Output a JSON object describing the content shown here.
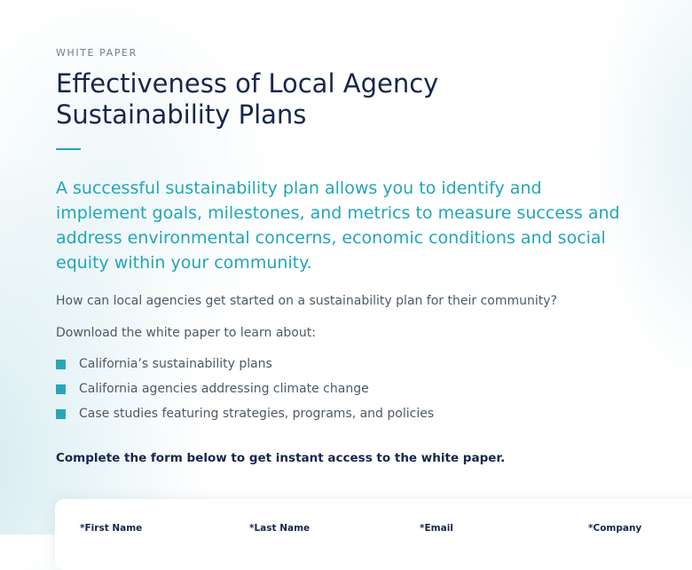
{
  "header": {
    "eyebrow": "WHITE PAPER",
    "title": "Effectiveness of Local Agency Sustainability Plans"
  },
  "body": {
    "lead": "A successful sustainability plan allows you to identify and implement goals, milestones, and metrics to measure success and address environmental concerns, economic conditions and social equity within your community.",
    "question": "How can local agencies get started on a sustainability plan for their community?",
    "intro": "Download the white paper to learn about:",
    "bullets": [
      "California’s sustainability plans",
      "California agencies addressing climate change",
      "Case studies featuring strategies, programs, and policies"
    ],
    "cta": "Complete the form below to get instant access to the white paper."
  },
  "form": {
    "first_name_label": "*First Name",
    "last_name_label": "*Last Name",
    "email_label": "*Email",
    "company_label": "*Company"
  },
  "colors": {
    "accent": "#2aa5b8",
    "heading": "#16264d",
    "body_text": "#4c5a66"
  }
}
